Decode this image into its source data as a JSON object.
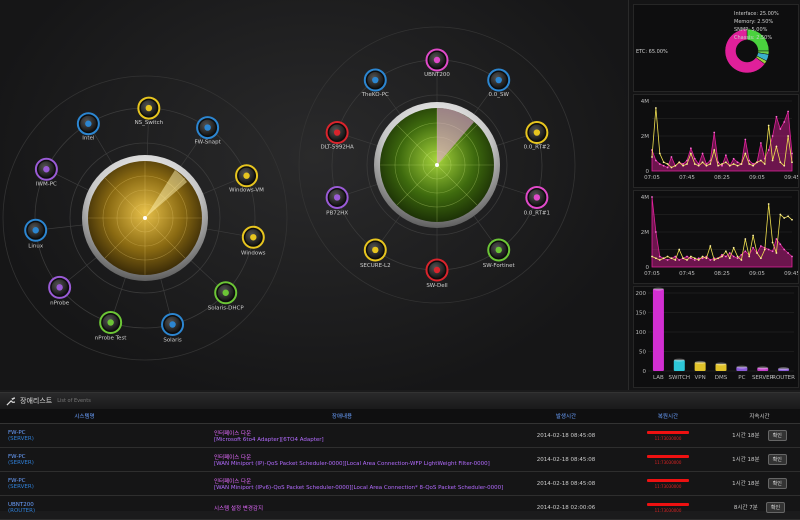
{
  "radar_left": {
    "nodes": [
      {
        "label": "NS_Switch",
        "icon": "phone-icon",
        "color": "#e7c51f"
      },
      {
        "label": "FW-Snapt",
        "icon": "server-icon",
        "color": "#2c86d1"
      },
      {
        "label": "Windows-VM",
        "icon": "power-icon",
        "color": "#e7c51f"
      },
      {
        "label": "Windows",
        "icon": "lightbulb-icon",
        "color": "#e7c51f"
      },
      {
        "label": "Solaris-DHCP",
        "icon": "sun-icon",
        "color": "#6cc536"
      },
      {
        "label": "Solaris",
        "icon": "monitor-icon",
        "color": "#2c86d1"
      },
      {
        "label": "nProbe Test",
        "icon": "diamond-icon",
        "color": "#6cc536"
      },
      {
        "label": "nProbe",
        "icon": "download-icon",
        "color": "#9a5bd6"
      },
      {
        "label": "Linux",
        "icon": "window-icon",
        "color": "#2c86d1"
      },
      {
        "label": "IWM-PC",
        "icon": "mic-icon",
        "color": "#9a5bd6"
      },
      {
        "label": "Intel",
        "icon": "mail-icon",
        "color": "#2c86d1"
      }
    ]
  },
  "radar_right": {
    "nodes": [
      {
        "label": "UBNT200",
        "icon": "pen-icon",
        "color": "#e04ac9"
      },
      {
        "label": "0.0_SW",
        "icon": "chip-icon",
        "color": "#2c86d1"
      },
      {
        "label": "0.0_RT#2",
        "icon": "bell-icon",
        "color": "#e7c51f"
      },
      {
        "label": "0.0_RT#1",
        "icon": "film-icon",
        "color": "#e04ac9"
      },
      {
        "label": "SW-Fortinet",
        "icon": "camera-icon",
        "color": "#6cc536"
      },
      {
        "label": "SW-Dell",
        "icon": "chart-icon",
        "color": "#d9242c"
      },
      {
        "label": "SECURE-L2",
        "icon": "person-icon",
        "color": "#e7c51f"
      },
      {
        "label": "PB72HX",
        "icon": "chat-icon",
        "color": "#9a5bd6"
      },
      {
        "label": "DLT-5992HA",
        "icon": "mushroom-icon",
        "color": "#d9242c"
      },
      {
        "label": "TheKO-PC",
        "icon": "laptop-icon",
        "color": "#2c86d1"
      }
    ]
  },
  "donut": {
    "slices": [
      {
        "label": "Interface: 25.00%",
        "value": 25,
        "color": "#4ad23e"
      },
      {
        "label": "Memory: 2.50%",
        "value": 2.5,
        "color": "#6fd24a"
      },
      {
        "label": "SNMP: 5.00%",
        "value": 5,
        "color": "#3bb0c9"
      },
      {
        "label": "Chassis: 2.50%",
        "value": 2.5,
        "color": "#9cd23e"
      },
      {
        "label": "ETC: 65.00%",
        "value": 65,
        "color": "#e0209a"
      }
    ]
  },
  "chart_data": [
    {
      "type": "area",
      "x": [
        "07:05",
        "07:45",
        "08:25",
        "09:05",
        "09:45"
      ],
      "yticks": [
        "0",
        "2M",
        "4M"
      ],
      "ylim": [
        0,
        4
      ],
      "series": [
        {
          "color": "#e0209a",
          "values": [
            1.2,
            0.6,
            0.4,
            0.3,
            0.2,
            0.8,
            0.3,
            0.5,
            0.4,
            0.6,
            1.3,
            0.7,
            0.4,
            1.0,
            0.4,
            0.6,
            2.2,
            0.5,
            0.3,
            0.9,
            0.3,
            0.7,
            0.5,
            0.4,
            1.8,
            0.6,
            0.4,
            0.5,
            1.6,
            0.7,
            1.2,
            2.0,
            3.1,
            2.4,
            2.8,
            3.4,
            1.0
          ]
        },
        {
          "color": "#f0e050",
          "values": [
            0.8,
            3.6,
            1.0,
            0.5,
            0.4,
            0.2,
            0.3,
            0.5,
            0.3,
            0.4,
            1.0,
            0.4,
            0.3,
            0.5,
            0.3,
            0.4,
            1.2,
            0.3,
            0.4,
            0.5,
            0.3,
            0.4,
            0.3,
            0.4,
            1.0,
            0.4,
            0.3,
            0.5,
            0.6,
            0.4,
            2.6,
            0.6,
            1.4,
            0.5,
            0.3,
            2.0,
            0.5
          ]
        }
      ]
    },
    {
      "type": "area",
      "x": [
        "07:05",
        "07:45",
        "08:25",
        "09:05",
        "09:45"
      ],
      "yticks": [
        "0",
        "2M",
        "4M"
      ],
      "ylim": [
        0,
        4
      ],
      "series": [
        {
          "color": "#e0209a",
          "values": [
            4.0,
            2.0,
            0.6,
            0.5,
            0.4,
            0.5,
            0.6,
            0.4,
            0.5,
            0.6,
            0.5,
            0.4,
            0.5,
            0.5,
            0.6,
            0.4,
            0.5,
            0.5,
            0.7,
            0.6,
            0.8,
            0.6,
            0.5,
            0.7,
            0.9,
            0.7,
            1.1,
            0.8,
            1.2,
            1.1,
            1.0,
            0.9,
            1.6,
            1.3,
            1.0,
            0.8,
            0.6
          ]
        },
        {
          "color": "#f0e050",
          "values": [
            0.6,
            0.5,
            0.4,
            0.5,
            0.6,
            0.5,
            0.4,
            1.0,
            0.5,
            0.4,
            0.6,
            0.5,
            0.4,
            0.6,
            0.5,
            1.2,
            0.4,
            0.5,
            0.6,
            0.9,
            0.5,
            1.1,
            0.6,
            0.4,
            1.6,
            0.6,
            1.8,
            0.8,
            0.5,
            1.0,
            3.6,
            1.4,
            0.8,
            3.0,
            2.8,
            2.9,
            2.7
          ]
        }
      ]
    },
    {
      "type": "bar",
      "categories": [
        "LAB",
        "SWITCH",
        "VPN",
        "DMS",
        "PC",
        "SERVER",
        "ROUTER"
      ],
      "values": [
        210,
        28,
        22,
        18,
        10,
        8,
        6
      ],
      "colors": [
        "#d22fd2",
        "#2dc7d8",
        "#e0c22a",
        "#e0c22a",
        "#8a5ad8",
        "#c33fc8",
        "#8a5ad8"
      ],
      "yticks": [
        "0",
        "50",
        "100",
        "150",
        "200"
      ],
      "ylim": [
        0,
        200
      ]
    }
  ],
  "events": {
    "title": "장애리스트",
    "subtitle": "List of Events",
    "columns": [
      "시스템명",
      "장애내용",
      "발생시간",
      "복원시간",
      "지속시간"
    ],
    "rows": [
      {
        "host": "FW-PC",
        "type": "(SERVER)",
        "ev1": "인터페이스 다운",
        "ev2": "[Microsoft 6to4 Adapter][6TO4 Adapter]",
        "time": "2014-02-18 08:45:08",
        "rec": "11:73030000",
        "dur": "1시간 18분"
      },
      {
        "host": "FW-PC",
        "type": "(SERVER)",
        "ev1": "인터페이스 다운",
        "ev2": "[WAN Miniport (IP)-QoS Packet Scheduler-0000][Local Area Connection-WFP LightWeight Filter-0000]",
        "time": "2014-02-18 08:45:08",
        "rec": "11:73030000",
        "dur": "1시간 18분"
      },
      {
        "host": "FW-PC",
        "type": "(SERVER)",
        "ev1": "인터페이스 다운",
        "ev2": "[WAN Miniport (IPv6)-QoS Packet Scheduler-0000][Local Area Connection* 8-QoS Packet Scheduler-0000]",
        "time": "2014-02-18 08:45:08",
        "rec": "11:73030000",
        "dur": "1시간 18분"
      },
      {
        "host": "UBNT200",
        "type": "(ROUTER)",
        "ev1": "시스템 설정 변경감지",
        "ev2": "",
        "time": "2014-02-18 02:00:06",
        "rec": "11:73030000",
        "dur": "8시간 7분"
      }
    ],
    "dur_button": "확인"
  }
}
